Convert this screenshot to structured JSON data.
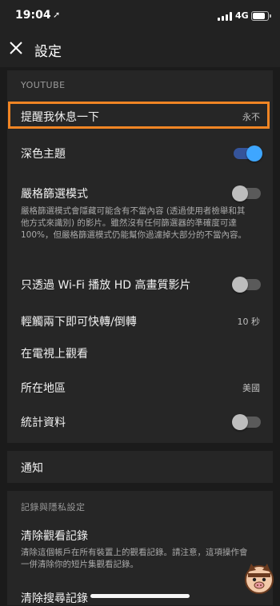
{
  "status_bar": {
    "time": "19:04",
    "network": "4G",
    "battery_level": 0.85
  },
  "header": {
    "title": "設定",
    "close_icon": "close-icon"
  },
  "youtube_section": {
    "header": "YOUTUBE",
    "remind_break": {
      "label": "提醒我休息一下",
      "value": "永不"
    },
    "dark_theme": {
      "label": "深色主題",
      "enabled": true
    },
    "restricted_mode": {
      "label": "嚴格篩選模式",
      "enabled": false,
      "description": "嚴格篩選模式會隱藏可能含有不當內容 (透過使用者檢舉和其他方式來識別) 的影片。雖然沒有任何篩選器的準確度可達 100%，但嚴格篩選模式仍能幫你過濾掉大部分的不當內容。"
    },
    "hd_wifi": {
      "label": "只透過 Wi-Fi 播放 HD 高畫質影片",
      "enabled": false
    },
    "double_tap": {
      "label": "輕觸兩下即可快轉/倒轉",
      "value": "10 秒"
    },
    "watch_on_tv": {
      "label": "在電視上觀看"
    },
    "location": {
      "label": "所在地區",
      "value": "美國"
    },
    "stats": {
      "label": "統計資料",
      "enabled": false
    }
  },
  "notifications": {
    "label": "通知"
  },
  "history_section": {
    "header": "記錄與隱私設定",
    "clear_watch": {
      "label": "清除觀看記錄",
      "description": "清除這個帳戶在所有裝置上的觀看記錄。請注意，這項操作會一併清除你的短片集觀看記錄。"
    },
    "clear_search": {
      "label": "清除搜尋記錄"
    }
  },
  "colors": {
    "highlight": "#f08524",
    "toggle_on": "#3ea6ff",
    "background": "#1b1b1b"
  }
}
